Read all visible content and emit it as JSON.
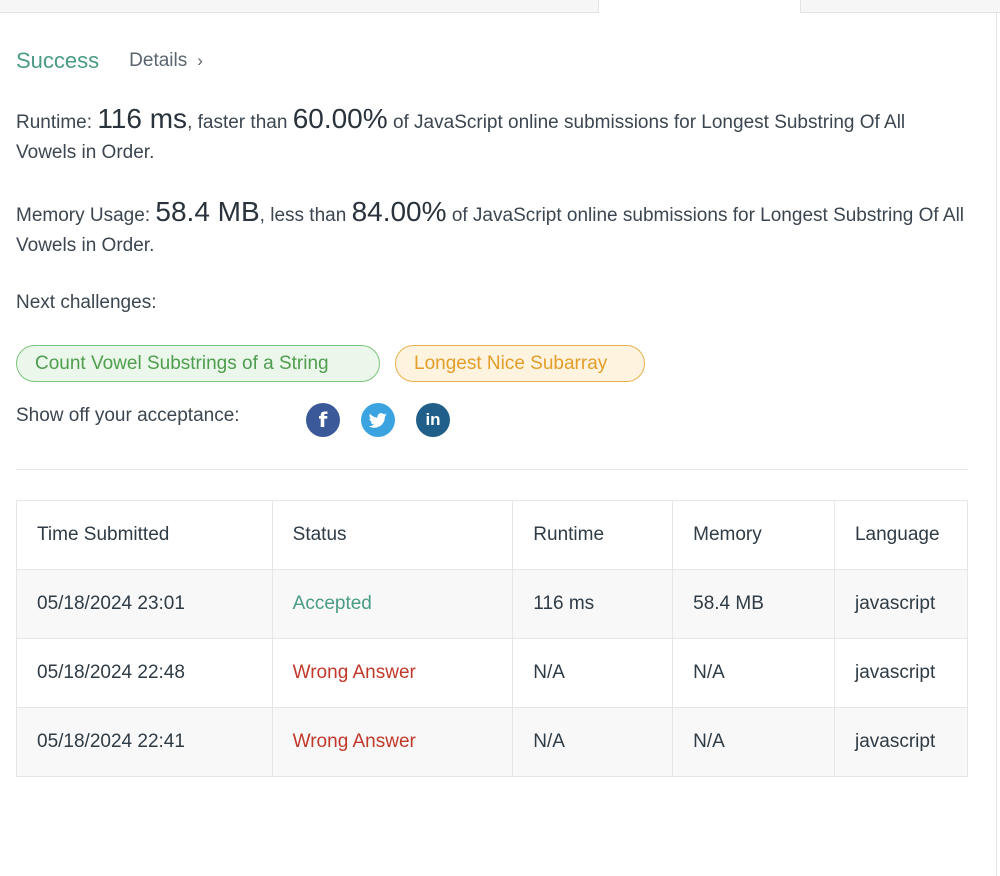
{
  "header": {
    "status": "Success",
    "details_label": "Details",
    "chevron": "›"
  },
  "runtime": {
    "label": "Runtime:",
    "value": "116 ms",
    "compare": ", faster than",
    "percent": "60.00%",
    "suffix": "of JavaScript online submissions for Longest Substring Of All Vowels in Order."
  },
  "memory": {
    "label": "Memory Usage:",
    "value": "58.4 MB",
    "compare": ", less than",
    "percent": "84.00%",
    "suffix": "of JavaScript online submissions for Longest Substring Of All Vowels in Order."
  },
  "next": {
    "label": "Next challenges:",
    "challenges": [
      {
        "label": "Count Vowel Substrings of a String",
        "color": "#4f9d4f"
      },
      {
        "label": "Longest Nice Subarray",
        "color": "#e39e29"
      }
    ]
  },
  "share": {
    "label": "Show off your acceptance:",
    "icons": [
      "facebook-icon",
      "twitter-icon",
      "linkedin-icon"
    ]
  },
  "table": {
    "headers": [
      "Time Submitted",
      "Status",
      "Runtime",
      "Memory",
      "Language"
    ],
    "rows": [
      {
        "time": "05/18/2024 23:01",
        "status": "Accepted",
        "runtime": "116 ms",
        "memory": "58.4 MB",
        "language": "javascript"
      },
      {
        "time": "05/18/2024 22:48",
        "status": "Wrong Answer",
        "runtime": "N/A",
        "memory": "N/A",
        "language": "javascript"
      },
      {
        "time": "05/18/2024 22:41",
        "status": "Wrong Answer",
        "runtime": "N/A",
        "memory": "N/A",
        "language": "javascript"
      }
    ]
  },
  "colors": {
    "success": "#4a9c86",
    "wrong": "#c0392b"
  }
}
